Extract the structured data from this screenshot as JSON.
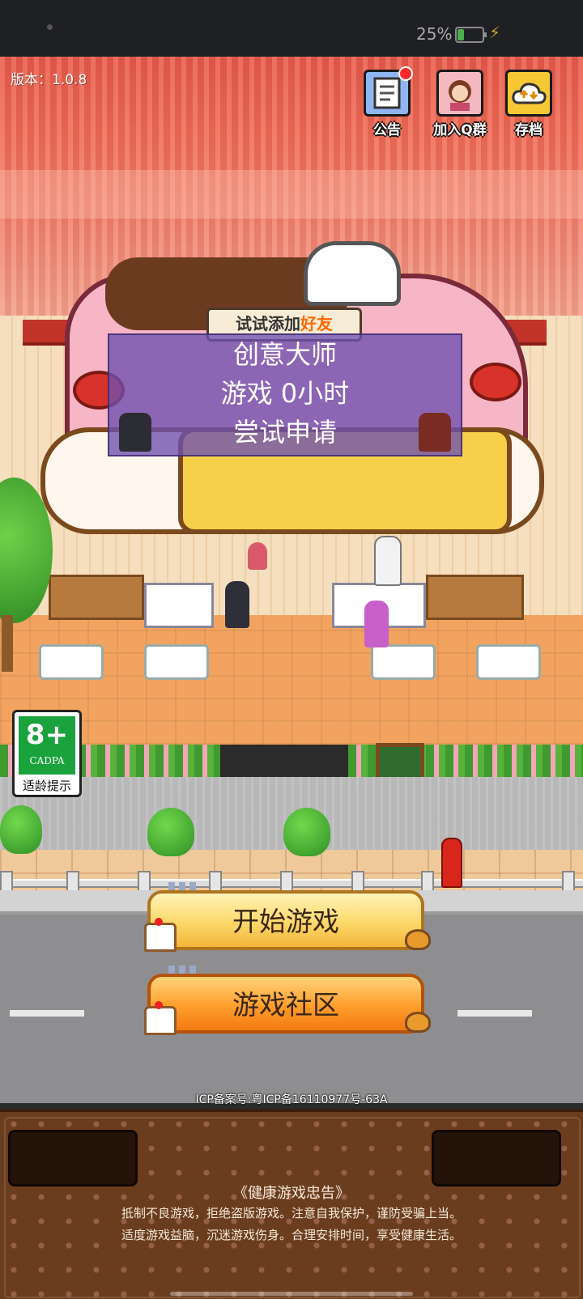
{
  "status_bar": {
    "battery_percent": "25%",
    "battery_level": 0.25
  },
  "version_label": "版本：1.0.8",
  "top_buttons": {
    "notice": {
      "label": "公告",
      "has_badge": true,
      "icon": "document-icon"
    },
    "qq_group": {
      "label": "加入Q群",
      "icon": "girl-avatar-icon"
    },
    "save": {
      "label": "存档",
      "icon": "cloud-sync-icon"
    }
  },
  "friend_tag": {
    "prefix": "试试添加",
    "highlight": "好友"
  },
  "friend_card": {
    "title": "创意大师",
    "playtime": "游戏 0小时",
    "action": "尝试申请"
  },
  "age_rating": {
    "age": "8+",
    "org": "CADPA",
    "tip": "适龄提示"
  },
  "buttons": {
    "start_game": "开始游戏",
    "community": "游戏社区"
  },
  "icp_text": "ICP备案号:粤ICP备16110977号-63A",
  "health_notice": {
    "title": "《健康游戏忠告》",
    "line1": "抵制不良游戏，拒绝盗版游戏。注意自我保护，谨防受骗上当。",
    "line2": "适度游戏益脑，沉迷游戏伤身。合理安排时间，享受健康生活。"
  },
  "colors": {
    "awning": "#e85a4a",
    "start_button": "#fcd96a",
    "community_button": "#ff9e2c",
    "friend_overlay": "#6e50af",
    "rating_green": "#1aa23d",
    "footer_brown": "#6b3d1f"
  }
}
